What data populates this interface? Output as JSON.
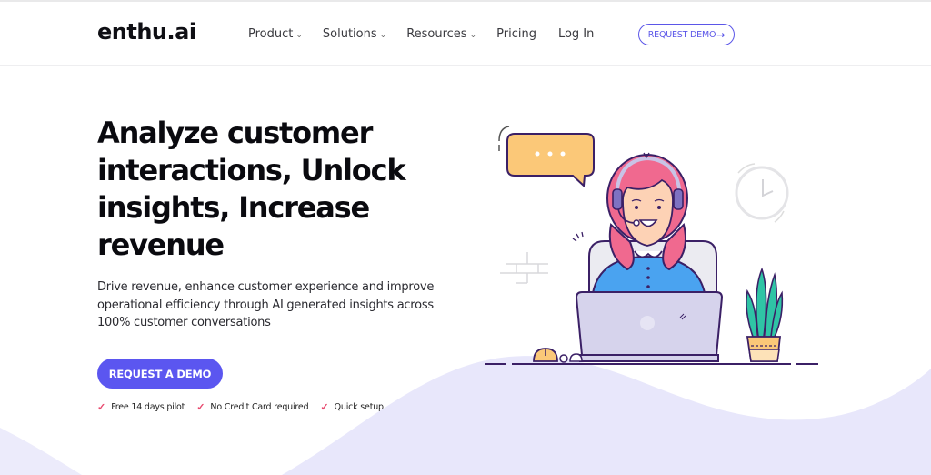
{
  "brand": {
    "logo_text": "enthu.ai",
    "accent_color": "#5b56f0",
    "check_color": "#e84a6f"
  },
  "nav": {
    "items": [
      {
        "label": "Product",
        "has_dropdown": true
      },
      {
        "label": "Solutions",
        "has_dropdown": true
      },
      {
        "label": "Resources",
        "has_dropdown": true
      },
      {
        "label": "Pricing",
        "has_dropdown": false
      },
      {
        "label": "Log In",
        "has_dropdown": false
      }
    ],
    "dropdown_icon": "chevron-down-icon",
    "cta_label": "REQUEST DEMO",
    "cta_icon": "arrow-right-icon"
  },
  "hero": {
    "title": "Analyze customer interactions, Unlock insights, Increase revenue",
    "subtitle": "Drive revenue, enhance customer experience and improve operational efficiency through AI generated insights across 100% customer conversations",
    "cta_label": "REQUEST A DEMO",
    "features": [
      {
        "icon": "check-icon",
        "label": "Free 14 days pilot"
      },
      {
        "icon": "check-icon",
        "label": "No Credit Card required"
      },
      {
        "icon": "check-icon",
        "label": "Quick setup"
      }
    ]
  },
  "illustration": {
    "description": "Support agent with headset at laptop",
    "chat_bubble_text": "• • •"
  }
}
